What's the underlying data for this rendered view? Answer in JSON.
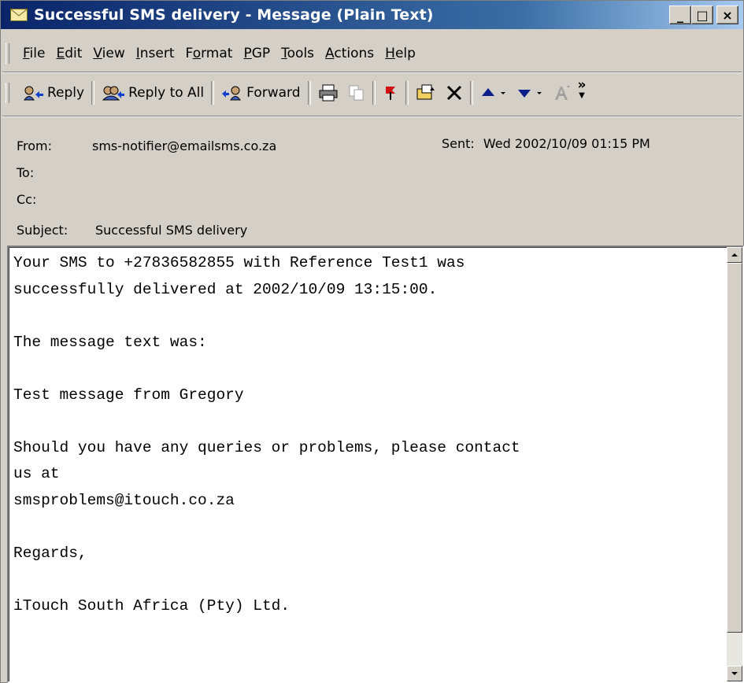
{
  "window": {
    "title": "Successful SMS delivery - Message (Plain Text)",
    "min_label": "_",
    "max_label": "□",
    "close_label": "×"
  },
  "menu": {
    "items": [
      {
        "label": "File",
        "key": "F"
      },
      {
        "label": "Edit",
        "key": "E"
      },
      {
        "label": "View",
        "key": "V"
      },
      {
        "label": "Insert",
        "key": "I"
      },
      {
        "label": "Format",
        "key": "o"
      },
      {
        "label": "PGP",
        "key": "P"
      },
      {
        "label": "Tools",
        "key": "T"
      },
      {
        "label": "Actions",
        "key": "A"
      },
      {
        "label": "Help",
        "key": "H"
      }
    ]
  },
  "toolbar": {
    "reply_label": "Reply",
    "reply_all_label": "Reply to All",
    "forward_label": "Forward",
    "overflow_label": "»"
  },
  "headers": {
    "from_label": "From:",
    "from_value": "sms-notifier@emailsms.co.za",
    "sent_label": "Sent:",
    "sent_value": "Wed 2002/10/09 01:15 PM",
    "to_label": "To:",
    "to_value": "",
    "cc_label": "Cc:",
    "cc_value": "",
    "subject_label": "Subject:",
    "subject_value": "Successful SMS delivery"
  },
  "message": {
    "body": "Your SMS to +27836582855 with Reference Test1 was\nsuccessfully delivered at 2002/10/09 13:15:00.\n\nThe message text was:\n\nTest message from Gregory\n\nShould you have any queries or problems, please contact\nus at\nsmsproblems@itouch.co.za\n\nRegards,\n\niTouch South Africa (Pty) Ltd."
  },
  "colors": {
    "titlebar_start": "#0a246a",
    "titlebar_end": "#a6caf0",
    "chrome": "#d4d0c8",
    "body_bg": "#ffffff"
  }
}
